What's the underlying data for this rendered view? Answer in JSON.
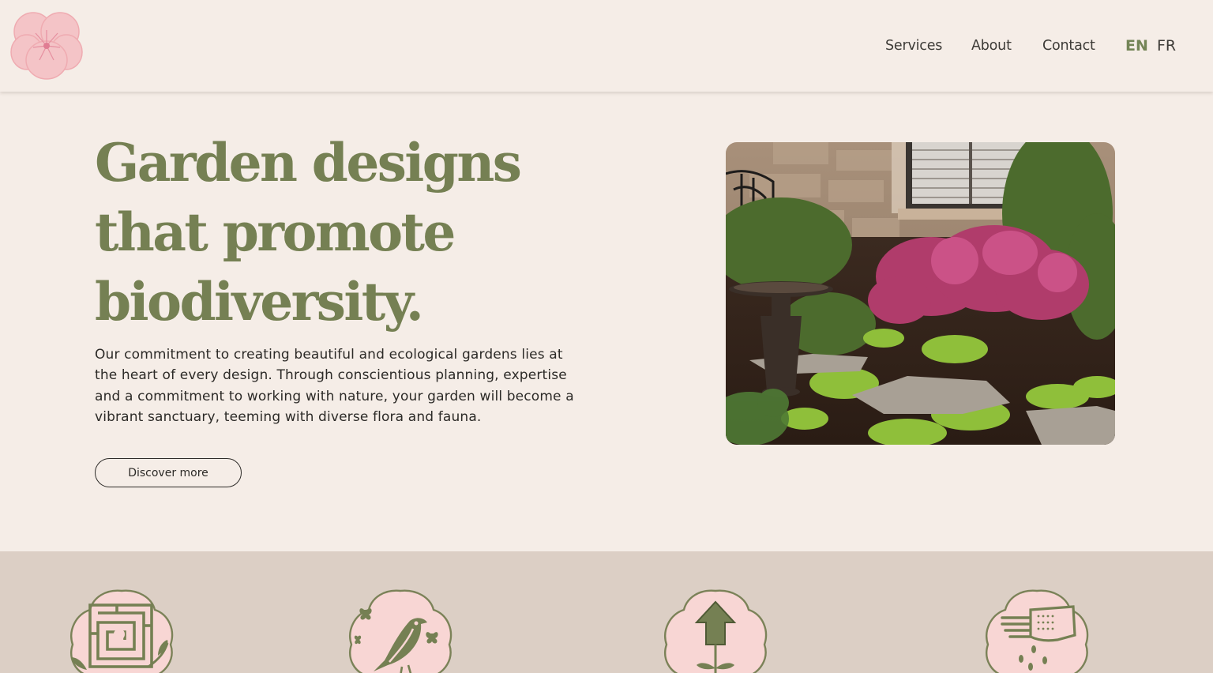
{
  "header": {
    "logo_icon": "pansy-flower-logo",
    "nav": [
      {
        "label": "Services"
      },
      {
        "label": "About"
      },
      {
        "label": "Contact"
      }
    ],
    "languages": [
      {
        "code": "EN",
        "active": true
      },
      {
        "code": "FR",
        "active": false
      }
    ]
  },
  "hero": {
    "title_lines": [
      "Garden designs",
      "that promote",
      "biodiversity."
    ],
    "body": "Our commitment to creating beautiful and ecological gardens lies at the heart of every design. Through conscientious planning, expertise and a commitment to working with nature, your garden will become a vibrant sanctuary, teeming with diverse flora and fauna.",
    "cta_label": "Discover more",
    "image_subject": "garden-photo-birdbath-flowers-stepping-stones"
  },
  "services": {
    "icons": [
      "maze-icon",
      "bird-butterfly-icon",
      "growth-arrow-plant-icon",
      "gloved-hand-seeds-icon"
    ]
  },
  "colors": {
    "background": "#f5ede7",
    "accent_green": "#758053",
    "band": "#dccfc5",
    "icon_pink": "#f8d6d4"
  }
}
